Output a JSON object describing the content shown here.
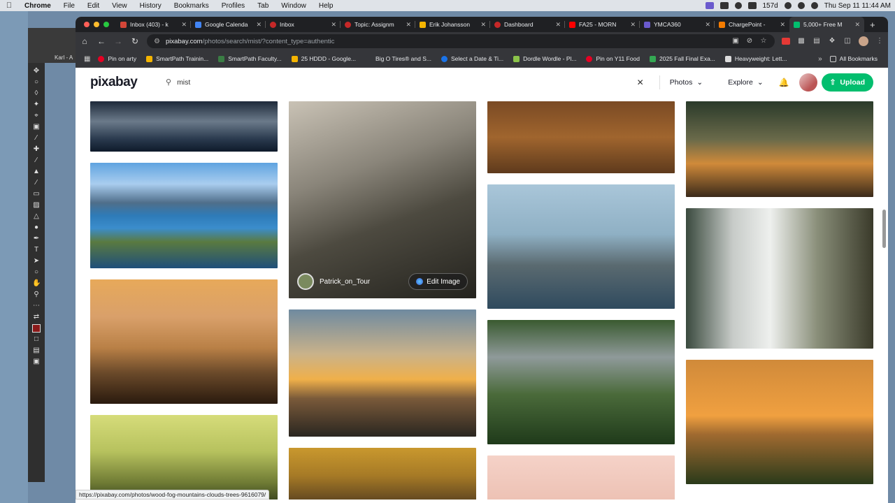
{
  "menubar": {
    "app": "Chrome",
    "items": [
      "File",
      "Edit",
      "View",
      "History",
      "Bookmarks",
      "Profiles",
      "Tab",
      "Window",
      "Help"
    ],
    "battery_label": "157d",
    "clock": "Thu Sep 11  11:44 AM"
  },
  "photoshop": {
    "tab_label": "Karl - A"
  },
  "tabs": [
    {
      "title": "Inbox (403) - k",
      "color": "#d44638"
    },
    {
      "title": "Google Calenda",
      "color": "#4285f4"
    },
    {
      "title": "Inbox",
      "color": "#c62828"
    },
    {
      "title": "Topic: Assignm",
      "color": "#c62828"
    },
    {
      "title": "Erik Johansson",
      "color": "#f4b400"
    },
    {
      "title": "Dashboard",
      "color": "#c62828"
    },
    {
      "title": "FA25 - MORN",
      "color": "#ff0000"
    },
    {
      "title": "YMCA360",
      "color": "#6a5acd"
    },
    {
      "title": "ChargePoint -",
      "color": "#f57c00"
    },
    {
      "title": "5,000+ Free M",
      "color": "#02be6e",
      "active": true
    }
  ],
  "omnibox": {
    "host": "pixabay.com",
    "path": "/photos/search/mist/?content_type=authentic"
  },
  "bookmarks": [
    {
      "label": "Pin on arty",
      "color": "#e60023"
    },
    {
      "label": "SmartPath Trainin...",
      "color": "#f4b400"
    },
    {
      "label": "SmartPath Faculty...",
      "color": "#3a7d44"
    },
    {
      "label": "25 HDDD - Google...",
      "color": "#f4b400"
    },
    {
      "label": "Big O Tires® and S...",
      "color": "#35363a"
    },
    {
      "label": "Select a Date & Ti...",
      "color": "#1a73e8"
    },
    {
      "label": "Dordle Wordle - Pl...",
      "color": "#8bc34a"
    },
    {
      "label": "Pin on Y11 Food",
      "color": "#e60023"
    },
    {
      "label": "2025 Fall Final Exa...",
      "color": "#34a853"
    },
    {
      "label": "Heavyweight: Lett...",
      "color": "#ddd"
    }
  ],
  "all_bookmarks": "All Bookmarks",
  "header": {
    "logo": "pixabay",
    "search_value": "mist",
    "photos_label": "Photos",
    "explore_label": "Explore",
    "upload_label": "Upload"
  },
  "hovered_image": {
    "author": "Patrick_on_Tour",
    "edit_label": "Edit Image"
  },
  "status_url": "https://pixabay.com/photos/wood-fog-mountains-clouds-trees-9616079/",
  "gallery_images": [
    {
      "name": "misty-mountain-valley"
    },
    {
      "name": "alpine-lake-island"
    },
    {
      "name": "golden-misty-hills"
    },
    {
      "name": "jungle-tree-person"
    },
    {
      "name": "foggy-forest-mountain"
    },
    {
      "name": "lone-tree-sunset"
    },
    {
      "name": "golden-mountain-layers"
    },
    {
      "name": "deer-in-tall-grass"
    },
    {
      "name": "sea-lion-rock"
    },
    {
      "name": "redwood-forest-road"
    },
    {
      "name": "pink-misty-scene"
    },
    {
      "name": "misty-lake-reflection"
    },
    {
      "name": "waterfall-rainbow"
    },
    {
      "name": "tree-sunrise-meadow"
    }
  ]
}
